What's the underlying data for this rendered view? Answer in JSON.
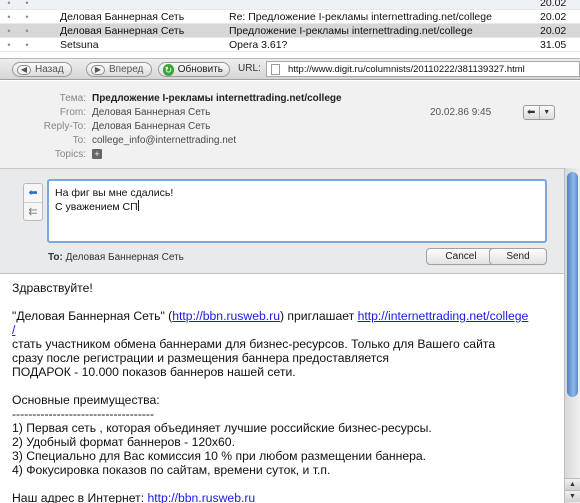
{
  "message_list": [
    {
      "sender": "",
      "subject": "",
      "date": "20.02",
      "style": "alt"
    },
    {
      "sender": "Деловая Баннерная Сеть",
      "subject": "Re: Предложение I-рекламы internettrading.net/college",
      "date": "20.02",
      "style": ""
    },
    {
      "sender": "Деловая Баннерная Сеть",
      "subject": "Предложение I-рекламы internettrading.net/college",
      "date": "20.02",
      "style": "sel"
    },
    {
      "sender": "Setsuna",
      "subject": "Opera 3.61?",
      "date": "31.05",
      "style": ""
    }
  ],
  "toolbar": {
    "back_label": "Назад",
    "forward_label": "Вперед",
    "refresh_label": "Обновить",
    "url_label": "URL:",
    "url": "http://www.digit.ru/columnists/20110222/381139327.html"
  },
  "header": {
    "subject_label": "Тема:",
    "subject": "Предложение I-рекламы internettrading.net/college",
    "from_label": "From:",
    "from": "Деловая Баннерная Сеть",
    "replyto_label": "Reply-To:",
    "replyto": "Деловая Баннерная Сеть",
    "to_label": "To:",
    "to": "college_info@internettrading.net",
    "topics_label": "Topics:",
    "date": "20.02.86 9:45"
  },
  "quick_reply": {
    "line1": "На фиг вы мне сдались!",
    "line2": "С уважением СП",
    "to_label": "To:",
    "to": "Деловая Баннерная Сеть",
    "cancel_label": "Cancel",
    "send_label": "Send"
  },
  "body": {
    "greeting": "Здравствуйте!",
    "intro_prefix": "\"Деловая Баннерная Сеть\" (",
    "link1": "http://bbn.rusweb.ru",
    "intro_mid": ") приглашает ",
    "link2a": "http://internettrading.net/college",
    "link2b": "/",
    "line3": "стать участником обмена баннерами для  бизнес-ресурсов. Только для  Вашего сайта",
    "line4": "сразу после регистрации и размещения баннера предоставляется",
    "line5": "ПОДАРОК - 10.000 показов баннеров нашей сети.",
    "adv_title": "Основные преимущества:",
    "divider": "-----------------------------------",
    "item1": "1) Первая сеть , которая объединяет лучшие российские бизнес-ресурсы.",
    "item2": "2) Удобный формат баннеров - 120x60.",
    "item3": "3) Специально для Вас комиссия 10 % при любом размещении баннера.",
    "item4": "4) Фокусировка показов по сайтам, времени суток, и т.п.",
    "addr_prefix": "Наш адрес в Интернет: ",
    "addr_link": "http://bbn.rusweb.ru"
  }
}
